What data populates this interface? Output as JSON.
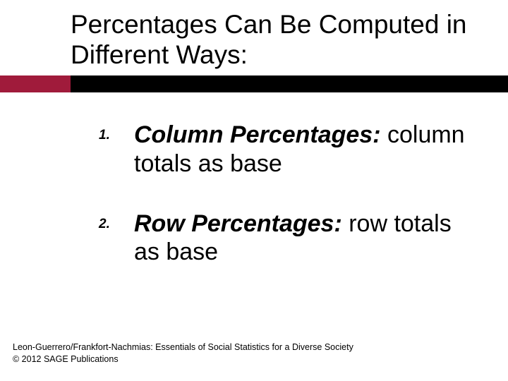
{
  "title": "Percentages Can Be Computed in Different Ways:",
  "items": [
    {
      "num": "1.",
      "lead": "Column Percentages: ",
      "rest": "column totals as base"
    },
    {
      "num": "2.",
      "lead": "Row Percentages: ",
      "rest": "row totals as base"
    }
  ],
  "footer_line1": "Leon-Guerrero/Frankfort-Nachmias: Essentials of Social Statistics for a Diverse Society",
  "footer_line2": "© 2012 SAGE Publications"
}
